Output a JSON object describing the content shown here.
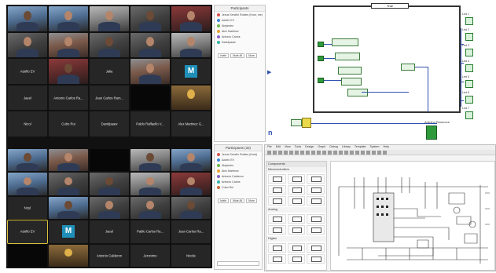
{
  "zoom_top": {
    "rows": [
      [
        {
          "k": "photo",
          "v": "blue"
        },
        {
          "k": "photo",
          "v": "blue"
        },
        {
          "k": "photo",
          "v": "light"
        },
        {
          "k": "photo"
        },
        {
          "k": "photo",
          "v": "red"
        }
      ],
      [
        {
          "k": "photo"
        },
        {
          "k": "photo",
          "v": "warm"
        },
        {
          "k": "photo"
        },
        {
          "k": "photo"
        },
        {
          "k": "photo",
          "v": "light"
        }
      ],
      [
        {
          "k": "name",
          "t": "Adolfo EV"
        },
        {
          "k": "photo",
          "v": "red"
        },
        {
          "k": "name",
          "t": "Jalia"
        },
        {
          "k": "photo",
          "v": "warm"
        },
        {
          "k": "m"
        }
      ],
      [
        {
          "k": "name",
          "t": "Jaeel"
        },
        {
          "k": "name",
          "t": "Antonio Carlos Ra..."
        },
        {
          "k": "name",
          "t": "Juan Carlos Ram..."
        },
        {
          "k": "black"
        },
        {
          "k": "cartoon"
        }
      ],
      [
        {
          "k": "name",
          "t": "Nicol"
        },
        {
          "k": "name",
          "t": "Cubo Rui"
        },
        {
          "k": "name",
          "t": "Davidpaaw"
        },
        {
          "k": "name",
          "t": "Pablo Raffaello V..."
        },
        {
          "k": "name",
          "t": "Alex Martinez G..."
        }
      ]
    ]
  },
  "zoom_bottom": {
    "rows": [
      [
        {
          "k": "photo",
          "v": "blue"
        },
        {
          "k": "photo",
          "v": "warm"
        },
        {
          "k": "black"
        },
        {
          "k": "photo",
          "v": "light"
        },
        {
          "k": "photo",
          "v": "blue"
        }
      ],
      [
        {
          "k": "photo",
          "v": "blue"
        },
        {
          "k": "photo"
        },
        {
          "k": "photo"
        },
        {
          "k": "photo",
          "v": "light"
        },
        {
          "k": "photo",
          "v": "red"
        }
      ],
      [
        {
          "k": "name",
          "t": "Noyl"
        },
        {
          "k": "photo",
          "v": "blue"
        },
        {
          "k": "photo"
        },
        {
          "k": "photo"
        },
        {
          "k": "photo"
        }
      ],
      [
        {
          "k": "name",
          "t": "Adolfo EV",
          "active": true
        },
        {
          "k": "m"
        },
        {
          "k": "name",
          "t": "Jaeel"
        },
        {
          "k": "name",
          "t": "Pablo Carlos Ra..."
        },
        {
          "k": "name",
          "t": "Juan Carlos Ra..."
        }
      ],
      [
        {
          "k": "black"
        },
        {
          "k": "cartoon"
        },
        {
          "k": "name",
          "t": "Antonio Calderon"
        },
        {
          "k": "name",
          "t": "Jeronimo"
        },
        {
          "k": "name",
          "t": "Nicole"
        }
      ]
    ]
  },
  "participants_top": {
    "title": "Participants",
    "rows": [
      "Jesús Serafín Robles (Host, me)",
      "Adolfo EV",
      "Alejandro",
      "Alex Martinez",
      "Antonio Carlos",
      "Davidpaaw"
    ],
    "buttons": [
      "Invite",
      "Mute All",
      "More"
    ]
  },
  "participants_bottom": {
    "title": "Participants (32)",
    "rows": [
      "Jesús Serafín Robles (Host)",
      "Adolfo EV",
      "Alejandro",
      "Alex Martinez",
      "Antonio Calderon",
      "Antonio Carlos",
      "Cubo Rui"
    ],
    "buttons": [
      "Invite",
      "Mute All",
      "More"
    ]
  },
  "labview": {
    "loop_label": "True",
    "led_labels": [
      "Led 1",
      "Led 2",
      "Led 3",
      "Led 4",
      "Led 5",
      "Led 6",
      "Led 7"
    ],
    "stop_label": "Arduino Resource",
    "iteration_label": "n"
  },
  "editor": {
    "menu": [
      "File",
      "Edit",
      "View",
      "Tools",
      "Design",
      "Graph",
      "Debug",
      "Library",
      "Template",
      "System",
      "Help"
    ],
    "library_title": "Components",
    "library_sections": [
      "Microcontrollers",
      "Analog",
      "Digital"
    ],
    "colors": {
      "accent": "#2f9a3a",
      "wire": "#2e4fae"
    }
  }
}
